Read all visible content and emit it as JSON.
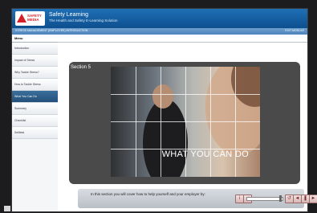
{
  "header": {
    "logo_text": "SAFETY\nMEDIA",
    "app_title": "Safety Learning",
    "app_subtitle": "The Health and Safety E-Learning Solution"
  },
  "subheader": {
    "course": "STRESS MANAGEMENT (EMPLOYEE) INTRODUCTION",
    "exit": "EXIT MODULE"
  },
  "sidebar": {
    "header": "Menu",
    "items": [
      {
        "label": "Introduction"
      },
      {
        "label": "Impact of Stress"
      },
      {
        "label": "Why Tackle Stress?"
      },
      {
        "label": "How to Tackle Stress"
      },
      {
        "label": "What You Can Do"
      },
      {
        "label": "Summary"
      },
      {
        "label": "Checklist"
      },
      {
        "label": "Sellitest"
      }
    ],
    "active_index": 4
  },
  "slide": {
    "section_title": "Section 5",
    "caption": "WHAT YOU CAN DO"
  },
  "controls": {
    "narration": "In this section you will cover how to help yourself and your employer by:",
    "volume_level": 0.9,
    "buttons": [
      {
        "name": "info-icon",
        "glyph": "i"
      },
      {
        "name": "volume-icon",
        "glyph": "◄"
      },
      {
        "name": "replay-icon",
        "glyph": "↺"
      },
      {
        "name": "previous-icon",
        "glyph": "◄"
      },
      {
        "name": "pause-icon",
        "glyph": "❚❚"
      },
      {
        "name": "next-icon",
        "glyph": "►"
      }
    ]
  },
  "colors": {
    "header": "#1f6fb5",
    "active_menu": "#2b5a86",
    "logo_red": "#d62027"
  }
}
